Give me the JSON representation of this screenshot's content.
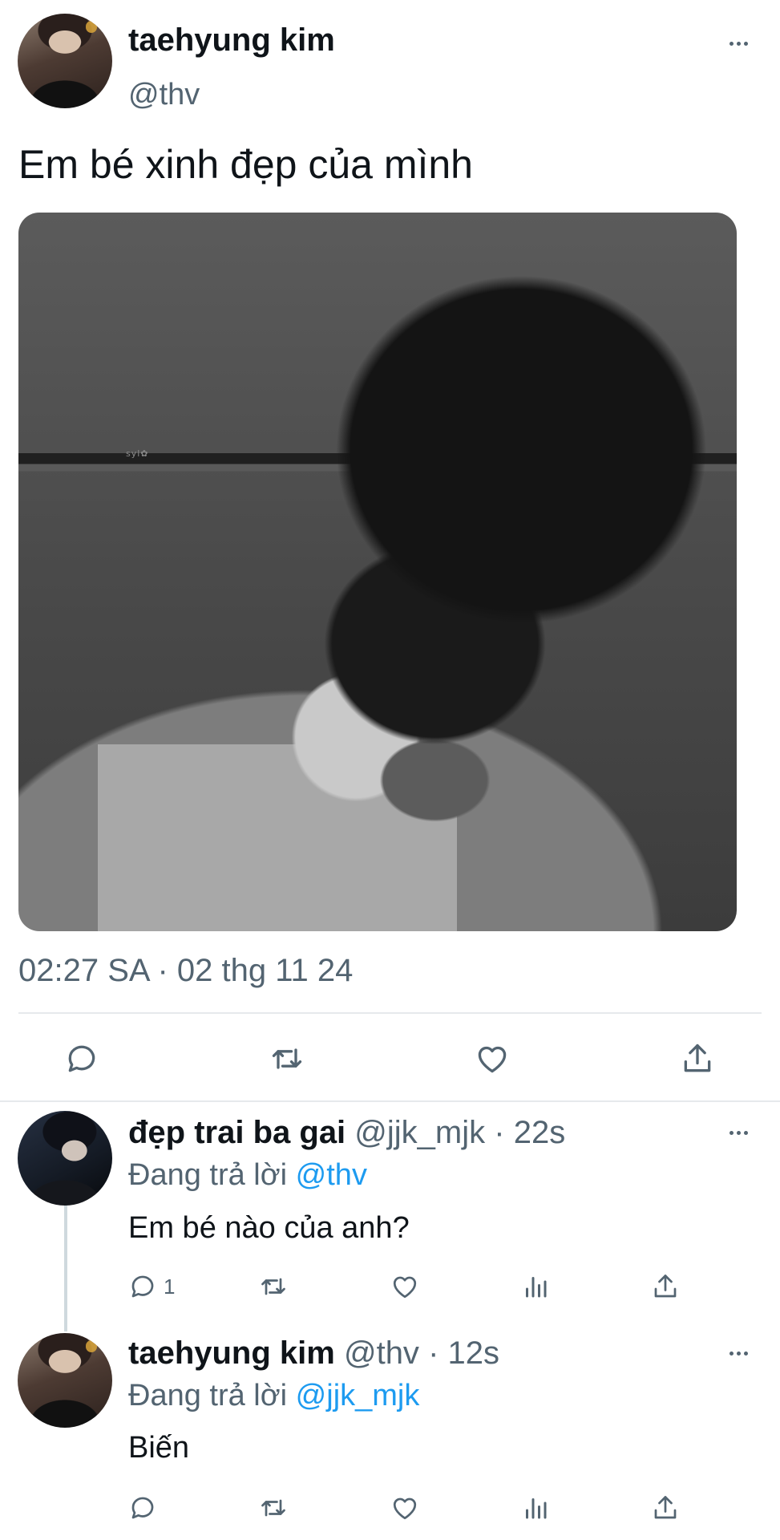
{
  "main_tweet": {
    "author_name": "taehyung kim",
    "author_handle": "@thv",
    "text": "Em bé xinh đẹp của mình",
    "image_watermark": "syl✿",
    "timestamp": "02:27 SA · 02 thg 11 24",
    "actions": {
      "reply_icon": "reply-icon",
      "retweet_icon": "retweet-icon",
      "like_icon": "heart-icon",
      "share_icon": "share-icon"
    }
  },
  "replies": [
    {
      "author_name": "đẹp trai ba gai",
      "author_handle": "@jjk_mjk",
      "time": "22s",
      "separator": "·",
      "replying_prefix": "Đang trả lời",
      "replying_to": "@thv",
      "text": "Em bé nào của anh?",
      "reply_count": "1"
    },
    {
      "author_name": "taehyung kim",
      "author_handle": "@thv",
      "time": "12s",
      "separator": "·",
      "replying_prefix": "Đang trả lời",
      "replying_to": "@jjk_mjk",
      "text": "Biến",
      "reply_count": ""
    }
  ],
  "colors": {
    "text": "#0f1419",
    "secondary": "#536471",
    "link": "#1d9bf0",
    "divider": "#e6e9ec"
  }
}
